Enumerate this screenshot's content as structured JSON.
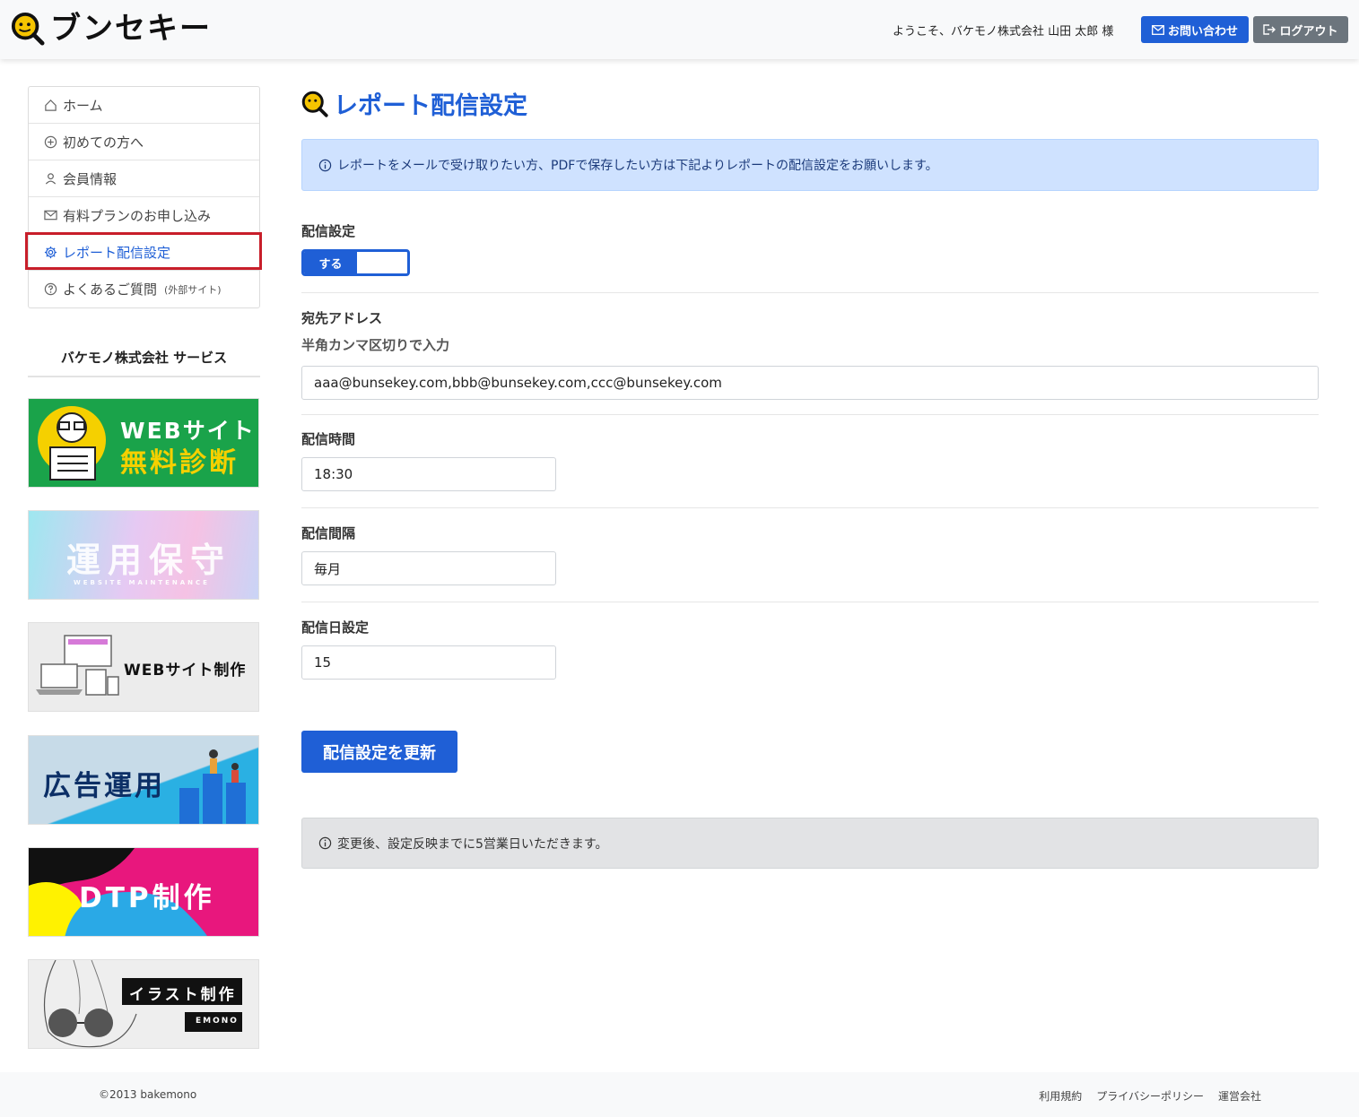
{
  "header": {
    "logo_text": "ブンセキー",
    "welcome": "ようこそ、バケモノ株式会社 山田 太郎 様",
    "contact_label": "お問い合わせ",
    "logout_label": "ログアウト"
  },
  "sidebar": {
    "items": [
      {
        "label": "ホーム",
        "icon": "home-icon"
      },
      {
        "label": "初めての方へ",
        "icon": "plus-circle-icon"
      },
      {
        "label": "会員情報",
        "icon": "person-icon"
      },
      {
        "label": "有料プランのお申し込み",
        "icon": "envelope-icon"
      },
      {
        "label": "レポート配信設定",
        "icon": "gear-icon",
        "active": true
      },
      {
        "label": "よくあるご質問",
        "icon": "question-circle-icon",
        "note": "(外部サイト)"
      }
    ],
    "services_title": "バケモノ株式会社 サービス",
    "banners": [
      {
        "line1": "WEBサイト",
        "line2": "無料診断"
      },
      {
        "line1": "運用保守",
        "line2": "WEBSITE MAINTENANCE"
      },
      {
        "line1": "WEBサイト制作"
      },
      {
        "line1": "広告運用"
      },
      {
        "line1": "DTP制作"
      },
      {
        "line1": "イラスト制作",
        "line2": "EMONO"
      }
    ]
  },
  "main": {
    "title": "レポート配信設定",
    "info": "レポートをメールで受け取りたい方、PDFで保存したい方は下記よりレポートの配信設定をお願いします。",
    "delivery_label": "配信設定",
    "toggle_label": "する",
    "address_label": "宛先アドレス",
    "address_hint": "半角カンマ区切りで入力",
    "address_value": "aaa@bunsekey.com,bbb@bunsekey.com,ccc@bunsekey.com",
    "time_label": "配信時間",
    "time_value": "18:30",
    "interval_label": "配信間隔",
    "interval_value": "毎月",
    "day_label": "配信日設定",
    "day_value": "15",
    "update_button": "配信設定を更新",
    "notice": "変更後、設定反映までに5営業日いただきます。"
  },
  "footer": {
    "copyright": "©2013 bakemono",
    "links": [
      "利用規約",
      "プライバシーポリシー",
      "運営会社"
    ]
  },
  "colors": {
    "accent": "#1f5fd6",
    "active_outline": "#c81e2a",
    "info_bg": "#cfe2ff",
    "notice_bg": "#e2e3e5"
  }
}
